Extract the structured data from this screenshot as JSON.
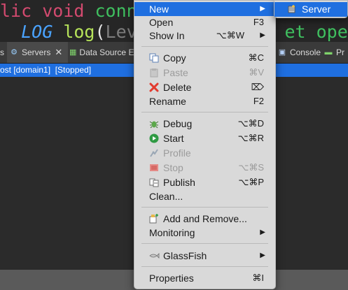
{
  "editor": {
    "line1": {
      "k1": "lic",
      "k2": "void",
      "k3": "connec"
    },
    "line2": {
      "a": "LOG",
      "b": "log",
      "c": "(",
      "d": "Level",
      "e": "et",
      "f": "opened"
    }
  },
  "tabs": [
    {
      "label": "s",
      "icon": "view-icon"
    },
    {
      "label": "Servers",
      "icon": "servers-icon"
    },
    {
      "label": "Data Source E",
      "icon": "data-source-icon"
    },
    {
      "label": "Console",
      "icon": "console-icon"
    },
    {
      "label": "Pr",
      "icon": "progress-icon"
    }
  ],
  "server_row": {
    "text": "ost [domain1]  [Stopped]"
  },
  "menu": {
    "items": [
      {
        "label": "New",
        "shortcut": "",
        "arrow": "▶",
        "highlighted": true
      },
      {
        "label": "Open",
        "shortcut": "F3"
      },
      {
        "label": "Show In",
        "shortcut": "⌥⌘W",
        "arrow": "▶"
      },
      {
        "label": "Copy",
        "shortcut": "⌘C",
        "icon": "copy-icon"
      },
      {
        "label": "Paste",
        "shortcut": "⌘V",
        "icon": "paste-icon",
        "disabled": true
      },
      {
        "label": "Delete",
        "shortcut": "⌦",
        "icon": "delete-icon"
      },
      {
        "label": "Rename",
        "shortcut": "F2"
      },
      {
        "label": "Debug",
        "shortcut": "⌥⌘D",
        "icon": "debug-icon"
      },
      {
        "label": "Start",
        "shortcut": "⌥⌘R",
        "icon": "start-icon"
      },
      {
        "label": "Profile",
        "shortcut": "",
        "icon": "profile-icon",
        "disabled": true
      },
      {
        "label": "Stop",
        "shortcut": "⌥⌘S",
        "icon": "stop-icon",
        "disabled": true
      },
      {
        "label": "Publish",
        "shortcut": "⌥⌘P",
        "icon": "publish-icon"
      },
      {
        "label": "Clean...",
        "shortcut": ""
      },
      {
        "label": "Add and Remove...",
        "shortcut": "",
        "icon": "add-remove-icon"
      },
      {
        "label": "Monitoring",
        "shortcut": "",
        "arrow": "▶"
      },
      {
        "label": "GlassFish",
        "shortcut": "",
        "arrow": "▶",
        "icon": "glassfish-icon"
      },
      {
        "label": "Properties",
        "shortcut": "⌘I"
      }
    ]
  },
  "submenu": {
    "label": "Server",
    "icon": "server-icon"
  },
  "colors": {
    "highlight": "#1f6fe0",
    "menu_bg": "#d9d9d9",
    "editor_bg": "#262626"
  }
}
